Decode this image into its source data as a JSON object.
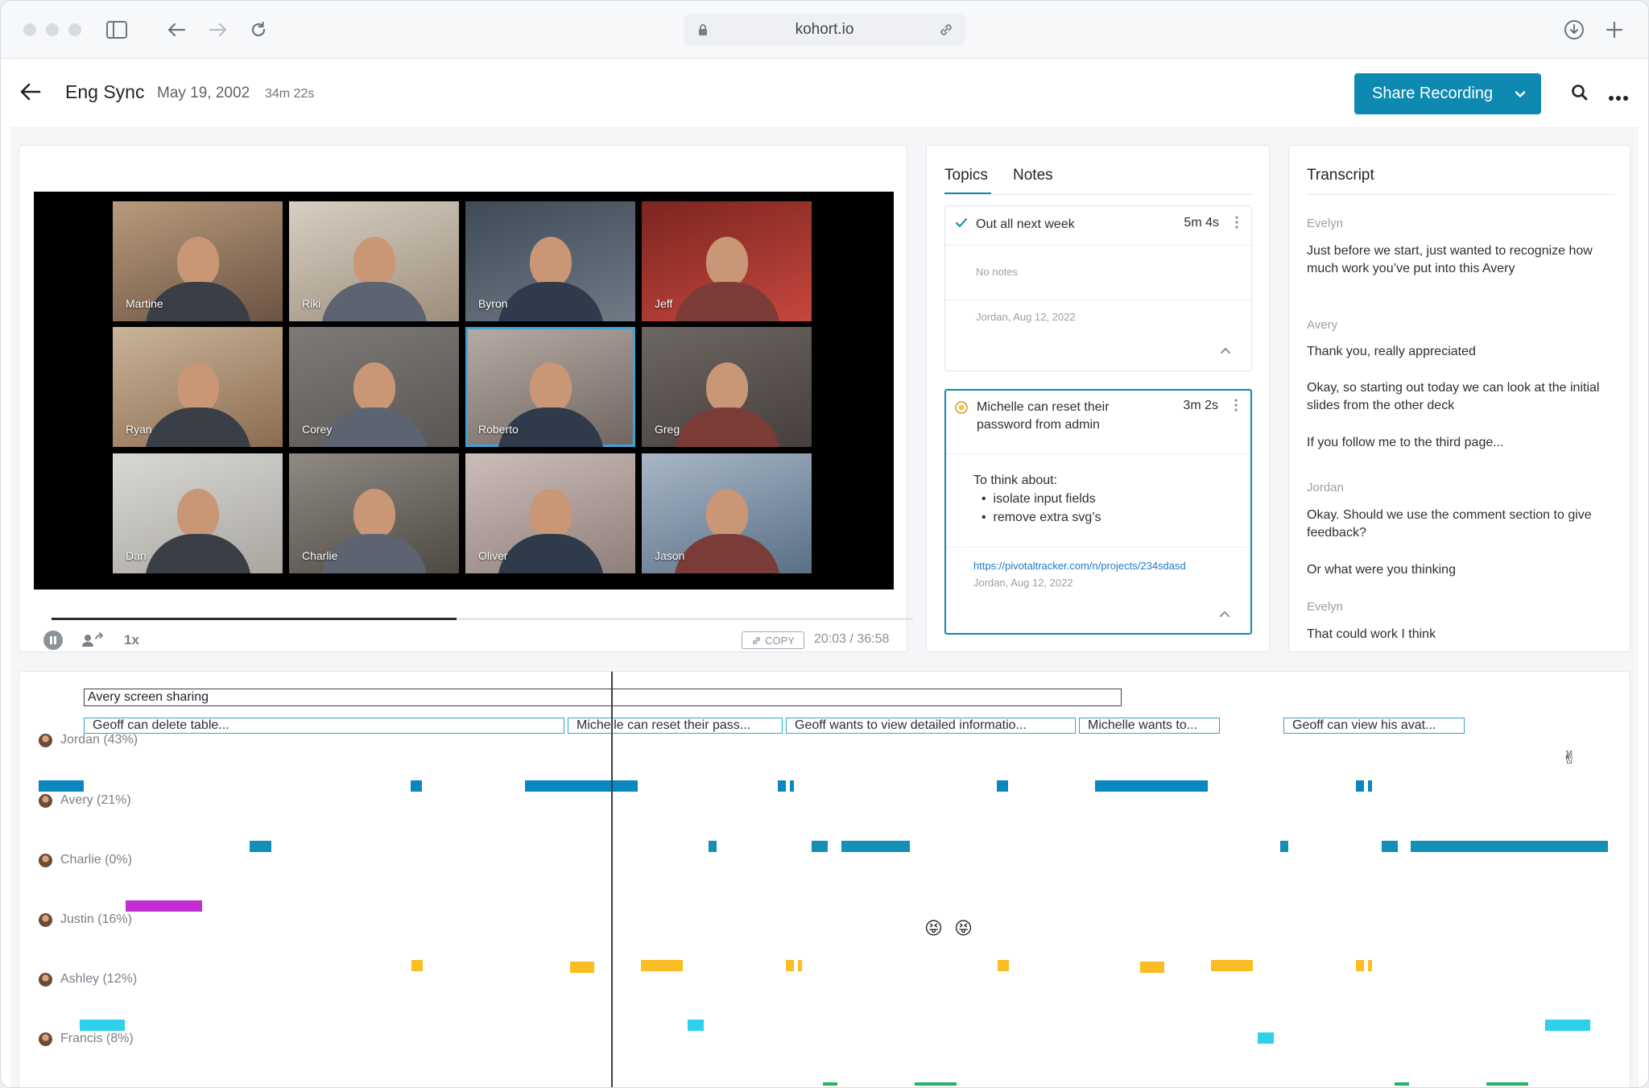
{
  "browser": {
    "url": "kohort.io"
  },
  "header": {
    "title": "Eng Sync",
    "date": "May 19, 2002",
    "duration": "34m 22s",
    "share_label": "Share Recording"
  },
  "video": {
    "participants": [
      "Martine",
      "Riki",
      "Byron",
      "Jeff",
      "Ryan",
      "Corey",
      "Roberto",
      "Greg",
      "Dan",
      "Charlie",
      "Oliver",
      "Jason"
    ],
    "active_speaker": "Roberto",
    "speed": "1x",
    "copy_label": "COPY",
    "time": "20:03 / 36:58",
    "progress": 0.47
  },
  "topics_panel": {
    "tabs": [
      "Topics",
      "Notes"
    ],
    "active_tab": "Topics",
    "topics": [
      {
        "title": "Out all next week",
        "duration": "5m 4s",
        "notes": "No notes",
        "author": "Jordan, Aug 12, 2022",
        "status": "done"
      },
      {
        "title": "Michelle can reset their password from admin",
        "duration": "3m 2s",
        "note_heading": "To think about:",
        "bullets": [
          "isolate input fields",
          "remove extra svg’s"
        ],
        "link": "https://pivotaltracker.com/n/projects/234sdasd",
        "author": "Jordan, Aug 12, 2022",
        "status": "in-progress"
      }
    ]
  },
  "transcript": {
    "title": "Transcript",
    "lines": [
      {
        "speaker": "Evelyn",
        "text": "Just before we start, just wanted to recognize how much work you’ve put into this Avery"
      },
      {
        "speaker": "Avery",
        "text": "Thank you, really appreciated"
      },
      {
        "speaker": "",
        "text": "Okay, so starting out today we can look at the initial slides from the other deck"
      },
      {
        "speaker": "",
        "text": "If you follow me to the third page..."
      },
      {
        "speaker": "Jordan",
        "text": "Okay. Should we use the comment section to give feedback?"
      },
      {
        "speaker": "",
        "text": "Or what were you thinking"
      },
      {
        "speaker": "Evelyn",
        "text": "That could work I think"
      }
    ]
  },
  "timeline": {
    "screenshare_label": "Avery screen sharing",
    "topic_chips": [
      "Geoff can delete table...",
      "Michelle can reset their pass...",
      "Geoff wants to view detailed informatio...",
      "Michelle wants to...",
      "Geoff can view his avat..."
    ],
    "speakers": [
      {
        "label": "Jordan (43%)",
        "color": "#0b87bf"
      },
      {
        "label": "Avery (21%)",
        "color": "#1490b4"
      },
      {
        "label": "Charlie (0%)",
        "color": "#c12fd0"
      },
      {
        "label": "Justin (16%)",
        "color": "#fbbd24"
      },
      {
        "label": "Ashley (12%)",
        "color": "#2ed0ea"
      },
      {
        "label": "Francis (8%)",
        "color": "#22b566"
      }
    ],
    "reactions": {
      "peace": "✌",
      "tongue": "😝"
    }
  },
  "colors": {
    "accent": "#0e8ab2"
  }
}
